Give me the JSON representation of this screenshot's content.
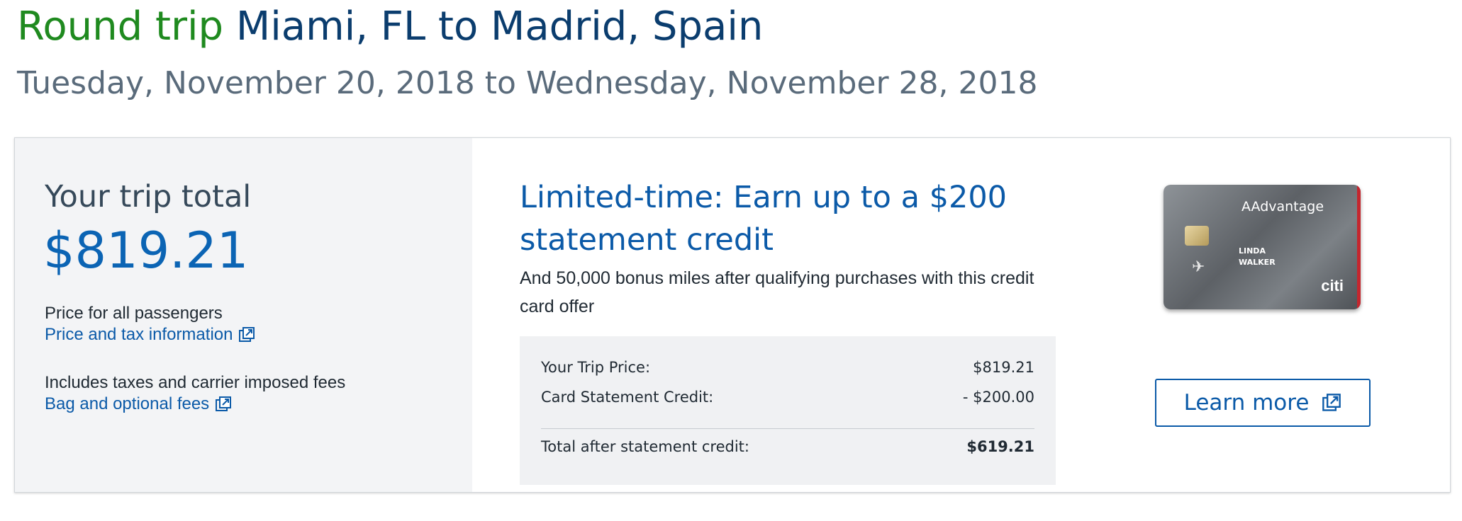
{
  "header": {
    "trip_type": "Round trip",
    "route": "Miami, FL to Madrid, Spain",
    "dates": "Tuesday, November 20, 2018 to Wednesday, November 28, 2018"
  },
  "summary": {
    "trip_total_label": "Your trip total",
    "trip_total_value": "$819.21",
    "price_note": "Price for all passengers",
    "price_tax_link": "Price and tax information",
    "fees_note": "Includes taxes and carrier imposed fees",
    "bag_fees_link": "Bag and optional fees"
  },
  "promo": {
    "title": "Limited-time: Earn up to a $200 statement credit",
    "subtitle": "And 50,000 bonus miles after qualifying purchases with this credit card offer",
    "rows": [
      {
        "label": "Your Trip Price:",
        "value": "$819.21"
      },
      {
        "label": "Card Statement Credit:",
        "value": "- $200.00"
      }
    ],
    "total": {
      "label": "Total after statement credit:",
      "value": "$619.21"
    },
    "learn_more_label": "Learn more"
  },
  "card": {
    "brand": "AAdvantage",
    "holder": "LINDA\nWALKER",
    "issuer": "citi"
  },
  "colors": {
    "trip_type": "#1f8a1f",
    "route": "#0b3d6e",
    "link": "#0b5aa8",
    "total": "#0b64b4"
  },
  "icons": [
    "external-link-icon",
    "plane-icon"
  ]
}
